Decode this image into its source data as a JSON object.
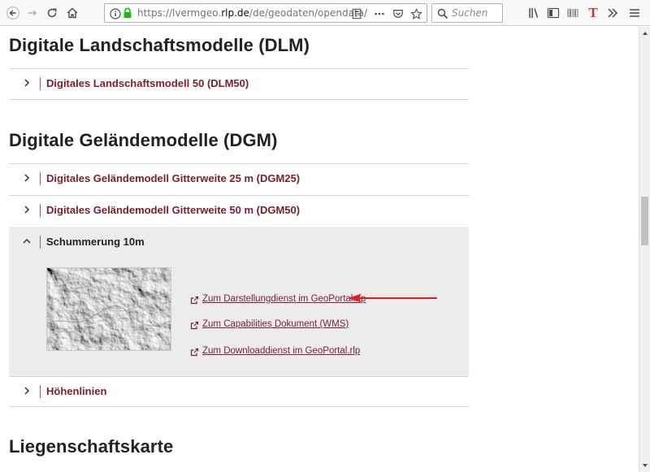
{
  "browser": {
    "url_host_prefix": "https://lvermgeo.",
    "url_host_main": "rlp.de",
    "url_path": "/de/geodaten/opendata/",
    "search_placeholder": "Suchen",
    "t_icon_label": "T"
  },
  "sections": {
    "dlm": {
      "heading": "Digitale Landschaftsmodelle (DLM)",
      "items": [
        {
          "label": "Digitales Landschaftsmodell 50 (DLM50)"
        }
      ]
    },
    "dgm": {
      "heading": "Digitale Geländemodelle (DGM)",
      "items": [
        {
          "label": "Digitales Geländemodell Gitterweite 25 m (DGM25)"
        },
        {
          "label": "Digitales Geländemodell Gitterweite 50 m (DGM50)"
        }
      ],
      "expanded": {
        "label": "Schummerung 10m",
        "links": [
          {
            "label": "Zum Darstellungdienst im GeoPortal.rlp"
          },
          {
            "label": "Zum Capabilities Dokument (WMS)"
          },
          {
            "label": "Zum Downloaddienst im GeoPortal.rlp"
          }
        ]
      },
      "after_items": [
        {
          "label": "Höhenlinien"
        }
      ]
    },
    "liegenschaft": {
      "heading": "Liegenschaftskarte"
    }
  },
  "colors": {
    "accent": "#7a2030",
    "arrow": "#e02020",
    "expanded_bg": "#ececec"
  }
}
